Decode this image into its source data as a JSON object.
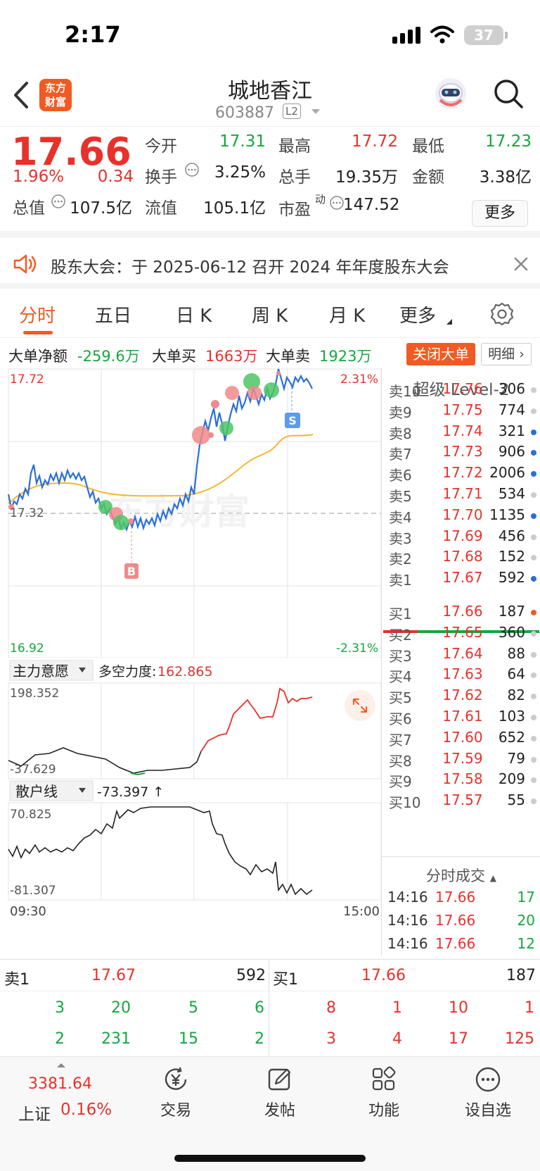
{
  "status_bar": {
    "time": "2:17",
    "battery": "37"
  },
  "header": {
    "logo": "东方\n财富",
    "name": "城地香江",
    "code": "603887",
    "level_badge": "L2"
  },
  "quote": {
    "price": "17.66",
    "change_pct": "1.96%",
    "change_amt": "0.34",
    "open_label": "今开",
    "open": "17.31",
    "high_label": "最高",
    "high": "17.72",
    "low_label": "最低",
    "low": "17.23",
    "turnover_label": "换手",
    "turnover": "3.25%",
    "volume_label": "总手",
    "volume": "19.35万",
    "amount_label": "金额",
    "amount": "3.38亿",
    "mktcap_label": "总值",
    "mktcap": "107.5亿",
    "float_label": "流值",
    "float": "105.1亿",
    "pe_label": "市盈",
    "pe_sup": "动",
    "pe": "147.52",
    "more": "更多"
  },
  "notice": {
    "text": "股东大会：于 2025-06-12 召开 2024 年年度股东大会"
  },
  "tabs": [
    "分时",
    "五日",
    "日 K",
    "周 K",
    "月 K",
    "更多"
  ],
  "big_order": {
    "net_label": "大单净额",
    "net": "-259.6万",
    "buy_label": "大单买",
    "buy": "1663万",
    "sell_label": "大单卖",
    "sell": "1923万",
    "close_btn": "关闭大单",
    "detail_btn": "明细"
  },
  "chart": {
    "top_price": "17.72",
    "top_pct": "2.31%",
    "mid_price": "17.32",
    "bottom_price": "16.92",
    "bottom_pct": "-2.31%",
    "watermark": "东方财富",
    "marker_b": "B",
    "marker_s": "S",
    "ind1_name": "主力意愿",
    "ind1_label": "多空力度:",
    "ind1_value": "162.865",
    "ind1_top": "198.352",
    "ind1_bottom": "-37.629",
    "ind2_name": "散户线",
    "ind2_value": "-73.397 ↑",
    "ind2_top": "70.825",
    "ind2_bottom": "-81.307",
    "time_start": "09:30",
    "time_end": "15:00"
  },
  "level2": {
    "title": "超级 Level-2",
    "asks": [
      {
        "label": "卖10",
        "price": "17.76",
        "vol": "306",
        "dot": "#cccccc"
      },
      {
        "label": "卖9",
        "price": "17.75",
        "vol": "774",
        "dot": "#cccccc"
      },
      {
        "label": "卖8",
        "price": "17.74",
        "vol": "321",
        "dot": "#2a6fd6"
      },
      {
        "label": "卖7",
        "price": "17.73",
        "vol": "906",
        "dot": "#2a6fd6"
      },
      {
        "label": "卖6",
        "price": "17.72",
        "vol": "2006",
        "dot": "#2a6fd6"
      },
      {
        "label": "卖5",
        "price": "17.71",
        "vol": "534",
        "dot": "#cccccc"
      },
      {
        "label": "卖4",
        "price": "17.70",
        "vol": "1135",
        "dot": "#2a6fd6"
      },
      {
        "label": "卖3",
        "price": "17.69",
        "vol": "456",
        "dot": "#cccccc"
      },
      {
        "label": "卖2",
        "price": "17.68",
        "vol": "152",
        "dot": "#cccccc"
      },
      {
        "label": "卖1",
        "price": "17.67",
        "vol": "592",
        "dot": "#2a6fd6"
      }
    ],
    "bids": [
      {
        "label": "买1",
        "price": "17.66",
        "vol": "187",
        "dot": "#f25a23"
      },
      {
        "label": "买2",
        "price": "17.65",
        "vol": "360",
        "dot": "#cccccc"
      },
      {
        "label": "买3",
        "price": "17.64",
        "vol": "88",
        "dot": "#cccccc"
      },
      {
        "label": "买4",
        "price": "17.63",
        "vol": "64",
        "dot": "#cccccc"
      },
      {
        "label": "买5",
        "price": "17.62",
        "vol": "82",
        "dot": "#cccccc"
      },
      {
        "label": "买6",
        "price": "17.61",
        "vol": "103",
        "dot": "#cccccc"
      },
      {
        "label": "买7",
        "price": "17.60",
        "vol": "652",
        "dot": "#cccccc"
      },
      {
        "label": "买8",
        "price": "17.59",
        "vol": "79",
        "dot": "#cccccc"
      },
      {
        "label": "买9",
        "price": "17.58",
        "vol": "209",
        "dot": "#cccccc"
      },
      {
        "label": "买10",
        "price": "17.57",
        "vol": "55",
        "dot": "#cccccc"
      }
    ],
    "ticks_title": "分时成交",
    "ticks": [
      {
        "time": "14:16",
        "price": "17.66",
        "vol": "17"
      },
      {
        "time": "14:16",
        "price": "17.66",
        "vol": "20"
      },
      {
        "time": "14:16",
        "price": "17.66",
        "vol": "12"
      }
    ]
  },
  "bottom_quote": {
    "sell_label": "卖1",
    "sell_price": "17.67",
    "sell_vol": "592",
    "buy_label": "买1",
    "buy_price": "17.66",
    "buy_vol": "187",
    "sell_row1": [
      "3",
      "20",
      "5",
      "6"
    ],
    "sell_row2": [
      "2",
      "231",
      "15",
      "2"
    ],
    "buy_row1": [
      "8",
      "1",
      "10",
      "1"
    ],
    "buy_row2": [
      "3",
      "4",
      "17",
      "125"
    ]
  },
  "navbar": {
    "index_value": "3381.64",
    "index_name": "上证",
    "index_pct": "0.16%",
    "trade": "交易",
    "post": "发帖",
    "functions": "功能",
    "watchlist": "设自选"
  },
  "icons": {
    "back": "chevron-left-icon",
    "search": "search-icon",
    "avatar": "robot-avatar-icon",
    "speaker": "speaker-icon",
    "close": "close-icon",
    "settings": "gear-icon",
    "expand": "expand-icon"
  },
  "colors": {
    "up": "#e8312b",
    "down": "#13a83e",
    "accent": "#f25a23",
    "price_line": "#2a6fd6",
    "avg_line": "#f5b731"
  }
}
